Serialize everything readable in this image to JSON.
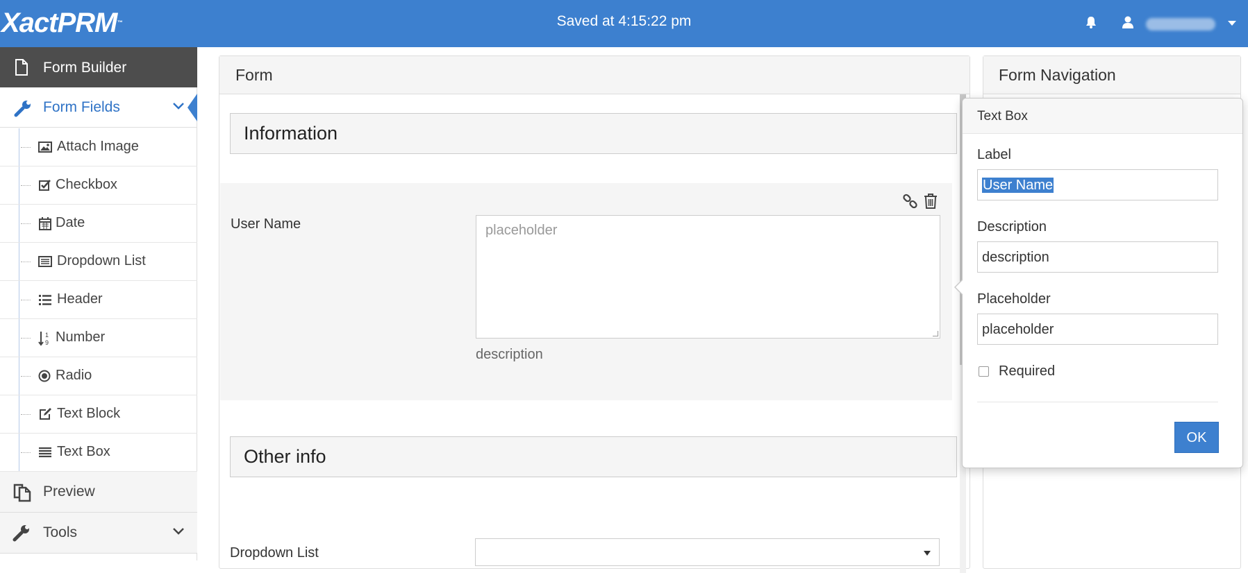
{
  "header": {
    "logo": "XactPRM",
    "logo_tm": "™",
    "status": "Saved at 4:15:22 pm",
    "icons": [
      "bell-icon",
      "user-icon"
    ],
    "accent": "#3d80cf"
  },
  "sidebar": {
    "builder_label": "Form Builder",
    "fields_label": "Form Fields",
    "field_types": [
      {
        "label": "Attach Image",
        "icon": "image-icon"
      },
      {
        "label": "Checkbox",
        "icon": "checkbox-icon"
      },
      {
        "label": "Date",
        "icon": "calendar-icon"
      },
      {
        "label": "Dropdown List",
        "icon": "list-box-icon"
      },
      {
        "label": "Header",
        "icon": "list-icon"
      },
      {
        "label": "Number",
        "icon": "sort-numeric-icon"
      },
      {
        "label": "Radio",
        "icon": "radio-icon"
      },
      {
        "label": "Text Block",
        "icon": "edit-icon"
      },
      {
        "label": "Text Box",
        "icon": "lines-icon"
      }
    ],
    "preview_label": "Preview",
    "tools_label": "Tools"
  },
  "form": {
    "title": "Form",
    "section1": "Information",
    "field_label": "User Name",
    "field_placeholder": "placeholder",
    "field_description": "description",
    "section2": "Other info",
    "dropdown_label": "Dropdown List"
  },
  "nav": {
    "title": "Form Navigation"
  },
  "popover": {
    "title": "Text Box",
    "label_label": "Label",
    "label_value": "User Name",
    "description_label": "Description",
    "description_value": "description",
    "placeholder_label": "Placeholder",
    "placeholder_value": "placeholder",
    "required_label": "Required",
    "ok_label": "OK"
  }
}
